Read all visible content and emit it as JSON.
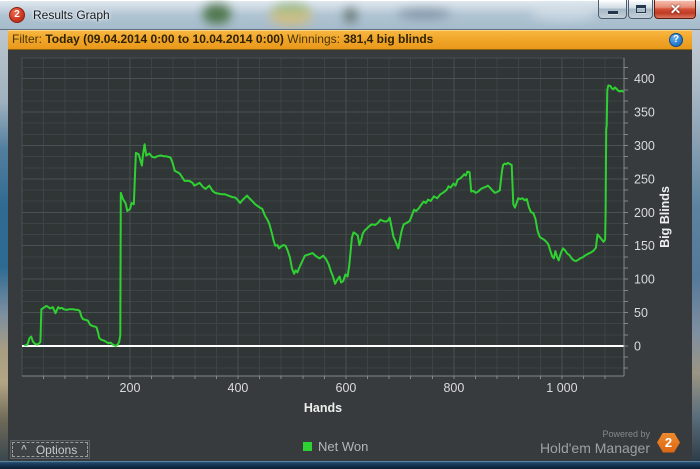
{
  "window": {
    "title": "Results Graph",
    "icon_glyph": "2"
  },
  "filter_bar": {
    "filter_label": "Filter:",
    "filter_value": "Today (09.04.2014 0:00 to 10.04.2014 0:00)",
    "winnings_label": "Winnings:",
    "winnings_value": "381,4 big blinds",
    "help_glyph": "?"
  },
  "footer": {
    "options_caret": "^",
    "options_label": "Options",
    "powered_by": "Powered by",
    "brand_name": "Hold'em Manager",
    "brand_badge": "2"
  },
  "chart_data": {
    "type": "line",
    "xlabel": "Hands",
    "ylabel": "Big Blinds",
    "xlim": [
      0,
      1115
    ],
    "ylim": [
      -45,
      431
    ],
    "x_minor_step": 40,
    "y_minor_step": 16.6667,
    "x_ticks": [
      {
        "value": 200,
        "label": "200"
      },
      {
        "value": 400,
        "label": "400"
      },
      {
        "value": 600,
        "label": "600"
      },
      {
        "value": 800,
        "label": "800"
      },
      {
        "value": 1000,
        "label": "1 000"
      }
    ],
    "y_ticks": [
      {
        "value": 0,
        "label": "0"
      },
      {
        "value": 50,
        "label": "50"
      },
      {
        "value": 100,
        "label": "100"
      },
      {
        "value": 150,
        "label": "150"
      },
      {
        "value": 200,
        "label": "200"
      },
      {
        "value": 250,
        "label": "250"
      },
      {
        "value": 300,
        "label": "300"
      },
      {
        "value": 350,
        "label": "350"
      },
      {
        "value": 400,
        "label": "400"
      }
    ],
    "plot_bg": "#303536",
    "grid_minor": "#3d4447",
    "grid_major": "#4a5154",
    "axis_color": "#81888c",
    "tick_label_color": "#d9dbdc",
    "axis_title_color": "#edefef",
    "zero_line_color": "#ffffff",
    "legend_position": "bottom",
    "series": [
      {
        "name": "Net Won",
        "color": "#2fd032",
        "points": [
          [
            6,
            1
          ],
          [
            10,
            2
          ],
          [
            14,
            12
          ],
          [
            17,
            14
          ],
          [
            20,
            7
          ],
          [
            24,
            3
          ],
          [
            28,
            2
          ],
          [
            32,
            4
          ],
          [
            34,
            6
          ],
          [
            36,
            55
          ],
          [
            40,
            57
          ],
          [
            45,
            60
          ],
          [
            49,
            58
          ],
          [
            52,
            56
          ],
          [
            57,
            58
          ],
          [
            62,
            49
          ],
          [
            67,
            58
          ],
          [
            70,
            56
          ],
          [
            74,
            57
          ],
          [
            77,
            55
          ],
          [
            82,
            54
          ],
          [
            88,
            55
          ],
          [
            94,
            55
          ],
          [
            100,
            54
          ],
          [
            104,
            54
          ],
          [
            107,
            52
          ],
          [
            110,
            44
          ],
          [
            113,
            40
          ],
          [
            118,
            39
          ],
          [
            122,
            38
          ],
          [
            126,
            32
          ],
          [
            130,
            30
          ],
          [
            135,
            29
          ],
          [
            138,
            28
          ],
          [
            141,
            20
          ],
          [
            143,
            12
          ],
          [
            147,
            9
          ],
          [
            152,
            8
          ],
          [
            156,
            6
          ],
          [
            160,
            4
          ],
          [
            164,
            5
          ],
          [
            168,
            2
          ],
          [
            171,
            1
          ],
          [
            174,
            0
          ],
          [
            177,
            2
          ],
          [
            180,
            6
          ],
          [
            182,
            16
          ],
          [
            183,
            229
          ],
          [
            187,
            220
          ],
          [
            192,
            213
          ],
          [
            195,
            202
          ],
          [
            200,
            205
          ],
          [
            203,
            214
          ],
          [
            207,
            212
          ],
          [
            211,
            289
          ],
          [
            216,
            287
          ],
          [
            222,
            270
          ],
          [
            224,
            285
          ],
          [
            227,
            302
          ],
          [
            230,
            285
          ],
          [
            236,
            288
          ],
          [
            241,
            283
          ],
          [
            246,
            282
          ],
          [
            251,
            284
          ],
          [
            257,
            285
          ],
          [
            262,
            284
          ],
          [
            266,
            284
          ],
          [
            271,
            283
          ],
          [
            275,
            282
          ],
          [
            279,
            274
          ],
          [
            283,
            262
          ],
          [
            288,
            260
          ],
          [
            292,
            258
          ],
          [
            297,
            252
          ],
          [
            301,
            247
          ],
          [
            310,
            247
          ],
          [
            316,
            244
          ],
          [
            319,
            240
          ],
          [
            324,
            242
          ],
          [
            329,
            244
          ],
          [
            335,
            238
          ],
          [
            340,
            235
          ],
          [
            347,
            240
          ],
          [
            353,
            232
          ],
          [
            358,
            229
          ],
          [
            364,
            228
          ],
          [
            370,
            227
          ],
          [
            376,
            227
          ],
          [
            382,
            225
          ],
          [
            389,
            223
          ],
          [
            395,
            222
          ],
          [
            400,
            218
          ],
          [
            404,
            214
          ],
          [
            409,
            219
          ],
          [
            413,
            222
          ],
          [
            417,
            225
          ],
          [
            421,
            221
          ],
          [
            425,
            218
          ],
          [
            432,
            212
          ],
          [
            439,
            208
          ],
          [
            445,
            205
          ],
          [
            450,
            195
          ],
          [
            455,
            188
          ],
          [
            458,
            183
          ],
          [
            463,
            168
          ],
          [
            466,
            158
          ],
          [
            469,
            150
          ],
          [
            473,
            151
          ],
          [
            476,
            146
          ],
          [
            480,
            149
          ],
          [
            484,
            151
          ],
          [
            488,
            150
          ],
          [
            492,
            143
          ],
          [
            496,
            133
          ],
          [
            500,
            116
          ],
          [
            504,
            108
          ],
          [
            507,
            113
          ],
          [
            510,
            110
          ],
          [
            513,
            116
          ],
          [
            518,
            125
          ],
          [
            524,
            135
          ],
          [
            531,
            137
          ],
          [
            538,
            139
          ],
          [
            545,
            134
          ],
          [
            551,
            131
          ],
          [
            558,
            135
          ],
          [
            563,
            130
          ],
          [
            568,
            122
          ],
          [
            572,
            112
          ],
          [
            576,
            104
          ],
          [
            580,
            93
          ],
          [
            584,
            99
          ],
          [
            588,
            104
          ],
          [
            591,
            95
          ],
          [
            595,
            97
          ],
          [
            599,
            107
          ],
          [
            603,
            104
          ],
          [
            606,
            120
          ],
          [
            611,
            162
          ],
          [
            614,
            170
          ],
          [
            618,
            168
          ],
          [
            622,
            165
          ],
          [
            625,
            151
          ],
          [
            628,
            158
          ],
          [
            631,
            168
          ],
          [
            635,
            173
          ],
          [
            639,
            176
          ],
          [
            644,
            180
          ],
          [
            649,
            182
          ],
          [
            654,
            181
          ],
          [
            659,
            184
          ],
          [
            664,
            189
          ],
          [
            669,
            187
          ],
          [
            674,
            186
          ],
          [
            678,
            188
          ],
          [
            681,
            192
          ],
          [
            685,
            176
          ],
          [
            688,
            163
          ],
          [
            691,
            158
          ],
          [
            694,
            152
          ],
          [
            697,
            146
          ],
          [
            700,
            159
          ],
          [
            703,
            172
          ],
          [
            707,
            182
          ],
          [
            712,
            184
          ],
          [
            718,
            187
          ],
          [
            722,
            195
          ],
          [
            726,
            204
          ],
          [
            730,
            202
          ],
          [
            735,
            206
          ],
          [
            739,
            211
          ],
          [
            744,
            216
          ],
          [
            748,
            214
          ],
          [
            752,
            219
          ],
          [
            757,
            217
          ],
          [
            763,
            224
          ],
          [
            769,
            221
          ],
          [
            775,
            227
          ],
          [
            781,
            230
          ],
          [
            787,
            234
          ],
          [
            790,
            239
          ],
          [
            794,
            237
          ],
          [
            799,
            243
          ],
          [
            803,
            240
          ],
          [
            807,
            249
          ],
          [
            812,
            251
          ],
          [
            816,
            254
          ],
          [
            819,
            257
          ],
          [
            822,
            255
          ],
          [
            825,
            261
          ],
          [
            829,
            260
          ],
          [
            832,
            231
          ],
          [
            836,
            232
          ],
          [
            840,
            229
          ],
          [
            845,
            231
          ],
          [
            850,
            235
          ],
          [
            855,
            237
          ],
          [
            859,
            238
          ],
          [
            863,
            240
          ],
          [
            868,
            236
          ],
          [
            872,
            232
          ],
          [
            876,
            229
          ],
          [
            881,
            231
          ],
          [
            885,
            233
          ],
          [
            889,
            262
          ],
          [
            891,
            271
          ],
          [
            894,
            273
          ],
          [
            897,
            272
          ],
          [
            900,
            274
          ],
          [
            904,
            272
          ],
          [
            907,
            271
          ],
          [
            910,
            212
          ],
          [
            913,
            207
          ],
          [
            916,
            214
          ],
          [
            919,
            221
          ],
          [
            923,
            220
          ],
          [
            927,
            221
          ],
          [
            931,
            218
          ],
          [
            935,
            220
          ],
          [
            939,
            207
          ],
          [
            943,
            200
          ],
          [
            947,
            199
          ],
          [
            951,
            190
          ],
          [
            955,
            172
          ],
          [
            959,
            163
          ],
          [
            963,
            161
          ],
          [
            967,
            159
          ],
          [
            971,
            156
          ],
          [
            975,
            152
          ],
          [
            979,
            141
          ],
          [
            982,
            134
          ],
          [
            985,
            131
          ],
          [
            988,
            142
          ],
          [
            991,
            133
          ],
          [
            994,
            128
          ],
          [
            998,
            139
          ],
          [
            1002,
            146
          ],
          [
            1006,
            143
          ],
          [
            1010,
            138
          ],
          [
            1014,
            136
          ],
          [
            1018,
            131
          ],
          [
            1022,
            128
          ],
          [
            1026,
            127
          ],
          [
            1030,
            129
          ],
          [
            1034,
            131
          ],
          [
            1039,
            133
          ],
          [
            1044,
            136
          ],
          [
            1049,
            138
          ],
          [
            1054,
            140
          ],
          [
            1059,
            143
          ],
          [
            1063,
            147
          ],
          [
            1066,
            167
          ],
          [
            1070,
            163
          ],
          [
            1074,
            159
          ],
          [
            1077,
            156
          ],
          [
            1080,
            159
          ],
          [
            1081,
            200
          ],
          [
            1082,
            324
          ],
          [
            1083,
            330
          ],
          [
            1084,
            383
          ],
          [
            1086,
            390
          ],
          [
            1090,
            389
          ],
          [
            1092,
            386
          ],
          [
            1095,
            384
          ],
          [
            1098,
            387
          ],
          [
            1101,
            385
          ],
          [
            1104,
            382
          ],
          [
            1107,
            381
          ],
          [
            1110,
            382
          ],
          [
            1113,
            381
          ]
        ]
      }
    ]
  }
}
